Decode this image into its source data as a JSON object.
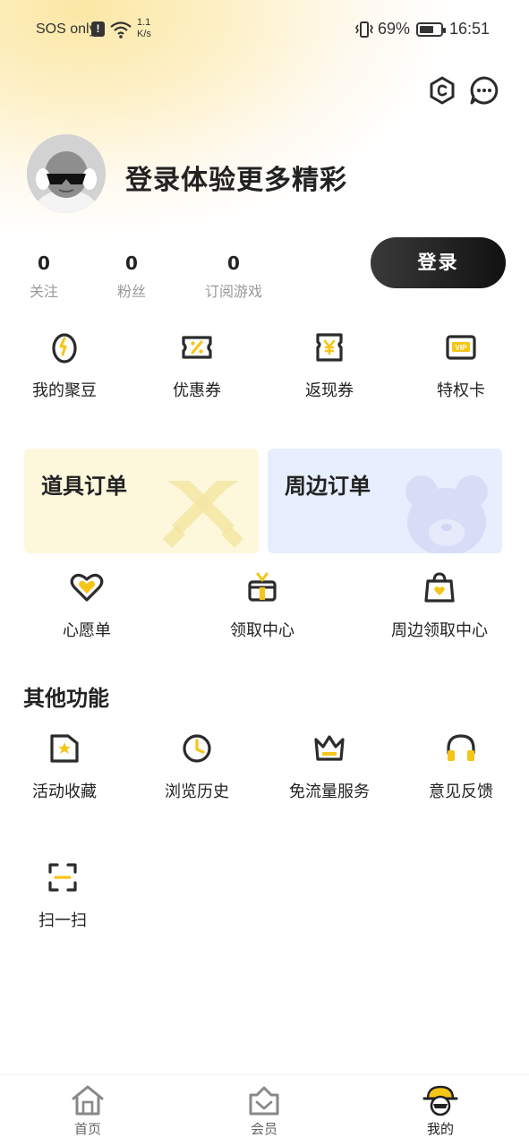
{
  "status_bar": {
    "carrier": "SOS only",
    "net_speed_value": "1.1",
    "net_speed_unit": "K/s",
    "battery_percent": "69%",
    "battery_level": 0.69,
    "time": "16:51"
  },
  "header": {
    "icons": [
      "coin-icon",
      "message-icon"
    ]
  },
  "profile": {
    "login_prompt": "登录体验更多精彩",
    "login_button": "登录",
    "stats": [
      {
        "value": "0",
        "label": "关注"
      },
      {
        "value": "0",
        "label": "粉丝"
      },
      {
        "value": "0",
        "label": "订阅游戏"
      }
    ]
  },
  "wallet": [
    {
      "label": "我的聚豆",
      "icon": "bean-icon"
    },
    {
      "label": "优惠券",
      "icon": "coupon-icon"
    },
    {
      "label": "返现券",
      "icon": "cashback-icon"
    },
    {
      "label": "特权卡",
      "icon": "vip-card-icon"
    }
  ],
  "orders": [
    {
      "label": "道具订单",
      "color": "#fdf8dc"
    },
    {
      "label": "周边订单",
      "color": "#e7eefd"
    }
  ],
  "services": [
    {
      "label": "心愿单",
      "icon": "heart-icon"
    },
    {
      "label": "领取中心",
      "icon": "gift-icon"
    },
    {
      "label": "周边领取中心",
      "icon": "bag-icon"
    }
  ],
  "other": {
    "title": "其他功能",
    "items": [
      {
        "label": "活动收藏",
        "icon": "favorite-folder-icon"
      },
      {
        "label": "浏览历史",
        "icon": "clock-icon"
      },
      {
        "label": "免流量服务",
        "icon": "crown-icon"
      },
      {
        "label": "意见反馈",
        "icon": "headset-icon"
      },
      {
        "label": "扫一扫",
        "icon": "scan-icon"
      }
    ]
  },
  "bottom_nav": [
    {
      "label": "首页",
      "icon": "home-icon",
      "active": false
    },
    {
      "label": "会员",
      "icon": "member-icon",
      "active": false
    },
    {
      "label": "我的",
      "icon": "profile-icon",
      "active": true
    }
  ],
  "colors": {
    "accent_yellow": "#f5c518",
    "icon_dark": "#2b2b2b",
    "muted_text": "#999999",
    "nav_inactive": "#888888"
  }
}
